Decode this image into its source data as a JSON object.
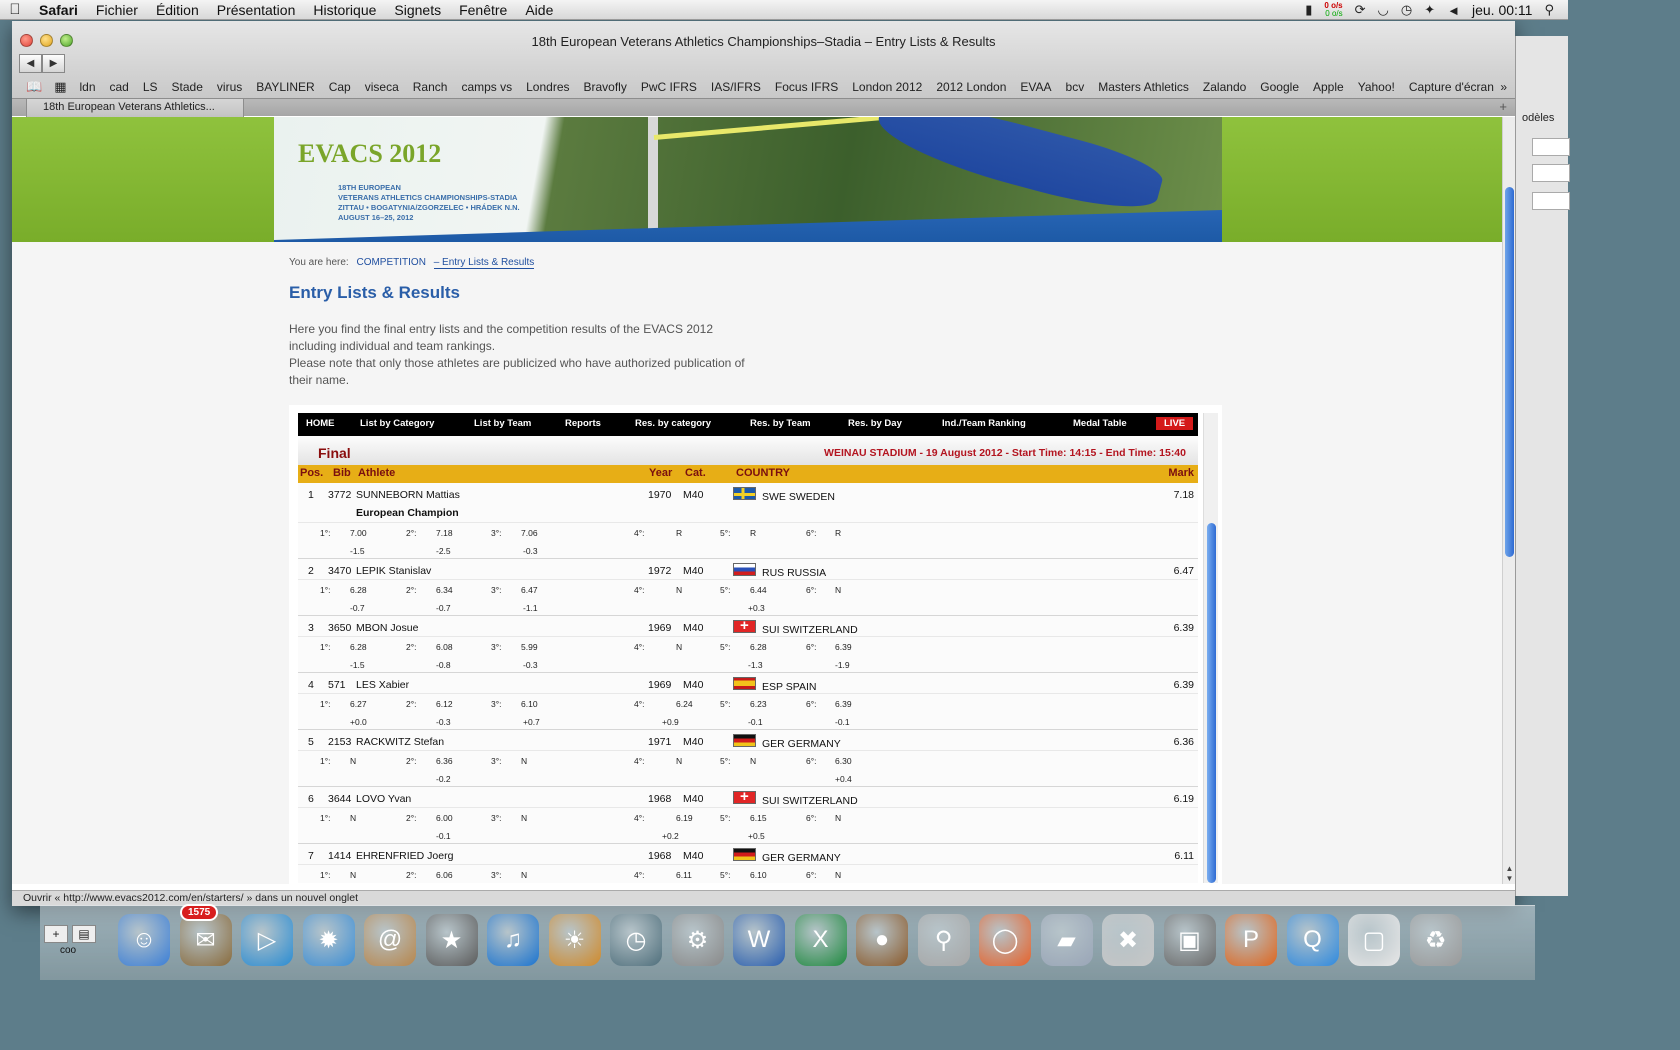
{
  "menubar": {
    "app": "Safari",
    "items": [
      "Fichier",
      "Édition",
      "Présentation",
      "Historique",
      "Signets",
      "Fenêtre",
      "Aide"
    ],
    "net_up": "0 o/s",
    "net_down": "0 o/s",
    "clock": "jeu. 00:11",
    "ghost_title": "EVAA"
  },
  "window": {
    "title": "18th European Veterans Athletics Championships–Stadia – Entry Lists & Results",
    "bookmarks": [
      "ldn",
      "cad",
      "LS",
      "Stade",
      "virus",
      "BAYLINER",
      "Cap",
      "viseca",
      "Ranch",
      "camps vs",
      "Londres",
      "Bravofly",
      "PwC IFRS",
      "IAS/IFRS",
      "Focus IFRS",
      "London 2012",
      "2012 London",
      "EVAA",
      "bcv",
      "Masters Athletics",
      "Zalando",
      "Google",
      "Apple",
      "Yahoo!",
      "Capture d'écran"
    ],
    "tab_label": "18th European Veterans Athletics...",
    "status": "Ouvrir « http://www.evacs2012.com/en/starters/ » dans un nouvel onglet"
  },
  "banner": {
    "logo": "EVACS 2012",
    "line1": "18TH EUROPEAN",
    "line2": "VETERANS ATHLETICS CHAMPIONSHIPS-STADIA",
    "line3": "ZITTAU • BOGATYNIA/ZGORZELEC • HRÁDEK N.N.",
    "line4": "AUGUST 16–25, 2012"
  },
  "page": {
    "breadcrumb_prefix": "You are here:",
    "breadcrumb_1": "COMPETITION",
    "breadcrumb_2": "– Entry Lists & Results",
    "title": "Entry Lists & Results",
    "intro_1": "Here you find the final entry lists and the competition results of the EVACS 2012 including individual and team rankings.",
    "intro_2": "Please note that only those athletes are publicized who have authorized publication of their  name."
  },
  "results_nav": [
    "HOME",
    "List by Category",
    "List by Team",
    "Reports",
    "Res. by category",
    "Res. by Team",
    "Res. by Day",
    "Ind./Team Ranking",
    "Medal Table",
    "LIVE"
  ],
  "results": {
    "round": "Final",
    "venue_line": "WEINAU STADIUM - 19 August 2012 - Start Time: 14:15 - End Time: 15:40",
    "columns": {
      "pos": "Pos.",
      "bib": "Bib",
      "athlete": "Athlete",
      "year": "Year",
      "cat": "Cat.",
      "country": "COUNTRY",
      "mark": "Mark"
    },
    "attempt_labels": [
      "1°:",
      "2°:",
      "3°:",
      "4°:",
      "5°:",
      "6°:"
    ],
    "athletes": [
      {
        "pos": "1",
        "bib": "3772",
        "name": "SUNNEBORN Mattias",
        "year": "1970",
        "cat": "M40",
        "country": "SWE SWEDEN",
        "flag": "swe",
        "mark": "7.18",
        "note": "European Champion",
        "att": [
          "7.00",
          "7.18",
          "7.06",
          "R",
          "R",
          "R"
        ],
        "wind": [
          "-1.5",
          "-2.5",
          "-0.3",
          "",
          "",
          ""
        ]
      },
      {
        "pos": "2",
        "bib": "3470",
        "name": "LEPIK Stanislav",
        "year": "1972",
        "cat": "M40",
        "country": "RUS RUSSIA",
        "flag": "rus",
        "mark": "6.47",
        "att": [
          "6.28",
          "6.34",
          "6.47",
          "N",
          "6.44",
          "N"
        ],
        "wind": [
          "-0.7",
          "-0.7",
          "-1.1",
          "",
          "+0.3",
          ""
        ]
      },
      {
        "pos": "3",
        "bib": "3650",
        "name": "MBON Josue",
        "year": "1969",
        "cat": "M40",
        "country": "SUI SWITZERLAND",
        "flag": "sui",
        "mark": "6.39",
        "att": [
          "6.28",
          "6.08",
          "5.99",
          "N",
          "6.28",
          "6.39"
        ],
        "wind": [
          "-1.5",
          "-0.8",
          "-0.3",
          "",
          "-1.3",
          "-1.9"
        ]
      },
      {
        "pos": "4",
        "bib": "571",
        "name": "LES Xabier",
        "year": "1969",
        "cat": "M40",
        "country": "ESP SPAIN",
        "flag": "esp",
        "mark": "6.39",
        "att": [
          "6.27",
          "6.12",
          "6.10",
          "6.24",
          "6.23",
          "6.39"
        ],
        "wind": [
          "+0.0",
          "-0.3",
          "+0.7",
          "+0.9",
          "-0.1",
          "-0.1"
        ]
      },
      {
        "pos": "5",
        "bib": "2153",
        "name": "RACKWITZ Stefan",
        "year": "1971",
        "cat": "M40",
        "country": "GER GERMANY",
        "flag": "ger",
        "mark": "6.36",
        "att": [
          "N",
          "6.36",
          "N",
          "N",
          "N",
          "6.30"
        ],
        "wind": [
          "",
          "-0.2",
          "",
          "",
          "",
          "+0.4"
        ]
      },
      {
        "pos": "6",
        "bib": "3644",
        "name": "LOVO Yvan",
        "year": "1968",
        "cat": "M40",
        "country": "SUI SWITZERLAND",
        "flag": "sui",
        "mark": "6.19",
        "att": [
          "N",
          "6.00",
          "N",
          "6.19",
          "6.15",
          "N"
        ],
        "wind": [
          "",
          "-0.1",
          "",
          "+0.2",
          "+0.5",
          ""
        ]
      },
      {
        "pos": "7",
        "bib": "1414",
        "name": "EHRENFRIED Joerg",
        "year": "1968",
        "cat": "M40",
        "country": "GER GERMANY",
        "flag": "ger",
        "mark": "6.11",
        "att": [
          "N",
          "6.06",
          "N",
          "6.11",
          "6.10",
          "N"
        ],
        "wind": [
          "",
          "",
          "",
          "",
          "",
          ""
        ]
      }
    ]
  },
  "right_window": {
    "label": "odèles"
  },
  "dock": {
    "mail_badge": "1575",
    "desktop_label": "coo",
    "apps": [
      "finder-icon",
      "mail-icon",
      "facetime-icon",
      "safari-icon",
      "address-book-icon",
      "imovie-icon",
      "itunes-icon",
      "iphoto-icon",
      "time-machine-icon",
      "system-preferences-icon",
      "word-icon",
      "excel-icon",
      "teddy-bear-icon",
      "keychain-icon",
      "lifebuoy-icon",
      "bottle-icon",
      "spam-icon",
      "photo-icon",
      "powerpoint-icon",
      "quicktime-icon",
      "preview-icon",
      "trash-icon"
    ]
  }
}
